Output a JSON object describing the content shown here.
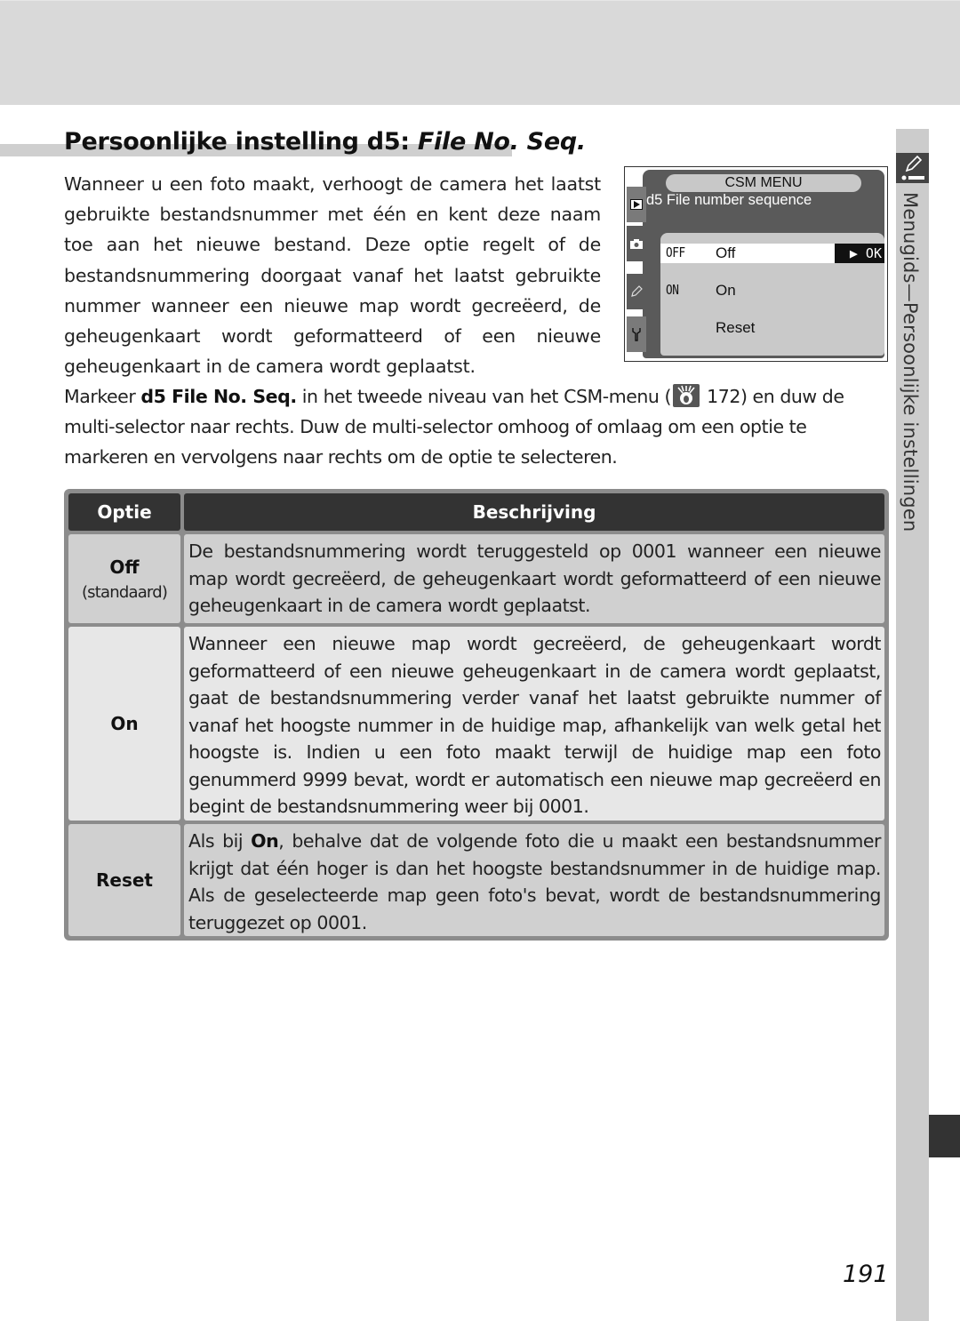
{
  "page": {
    "title_prefix": "Persoonlijke instelling d5: ",
    "title_italic": "File No. Seq.",
    "intro": "Wanneer u een foto maakt, verhoogt de camera het laatst gebruikte bestandsnummer met één en kent deze naam toe aan het nieuwe bestand. Deze optie regelt of de bestandsnummering doorgaat vanaf het laatst gebruikte nummer wanneer een nieuwe map wordt gecreëerd, de geheugenkaart wordt geformatteerd of een nieuwe geheugenkaart in de camera wordt geplaatst.",
    "instructions": {
      "before": "Markeer ",
      "bold": "d5 File No. Seq.",
      "middle": " in het tweede niveau van het CSM-menu (",
      "ref_icon": "menu-guide-icon",
      "ref_page": " 172) en duw de multi-selector naar rechts. Duw de multi-selector omhoog of omlaag om een optie te markeren en vervolgens naar rechts om de optie te selecteren."
    },
    "page_number": "191"
  },
  "camera_screen": {
    "header": "CSM MENU",
    "subtitle": "d5  File number sequence",
    "tabs": [
      "playback-icon",
      "camera-icon",
      "pencil-icon",
      "wrench-icon"
    ],
    "options": [
      {
        "code": "OFF",
        "label": "Off",
        "selected": true
      },
      {
        "code": "ON",
        "label": "On",
        "selected": false
      },
      {
        "code": "",
        "label": "Reset",
        "selected": false
      }
    ],
    "ok_label": "▶ OK"
  },
  "table": {
    "headers": {
      "option": "Optie",
      "description": "Beschrijving"
    },
    "rows": [
      {
        "option": "Off",
        "note": "(standaard)",
        "description": "De bestandsnummering wordt teruggesteld op 0001 wanneer een nieuwe map wordt gecreëerd, de geheugenkaart wordt geformatteerd of een nieuwe geheugenkaart in de camera wordt geplaatst."
      },
      {
        "option": "On",
        "note": "",
        "description": "Wanneer een nieuwe map wordt gecreëerd, de geheugenkaart wordt geformatteerd of een nieuwe geheugenkaart in de camera wordt geplaatst, gaat de bestandsnummering verder vanaf het laatst gebruikte nummer of vanaf het hoogste nummer in de huidige map, afhankelijk van welk getal het hoogste is. Indien u een foto maakt terwijl de huidige map een foto genummerd 9999 bevat, wordt er automatisch een nieuwe map gecreëerd en begint de bestandsnummering weer bij 0001."
      },
      {
        "option": "Reset",
        "note": "",
        "description_before": "Als bij ",
        "description_bold": "On",
        "description_after": ", behalve dat de volgende foto die u maakt een bestandsnummer krijgt dat één hoger is dan het hoogste bestandsnummer in de huidige map. Als de geselecteerde map geen foto's bevat, wordt de bestandsnummering teruggezet op 0001."
      }
    ]
  },
  "side_tab": {
    "icon": "custom-settings-pencil-icon",
    "section": "Menugids",
    "dash": "—",
    "subsection": "Persoonlijke instellingen"
  }
}
